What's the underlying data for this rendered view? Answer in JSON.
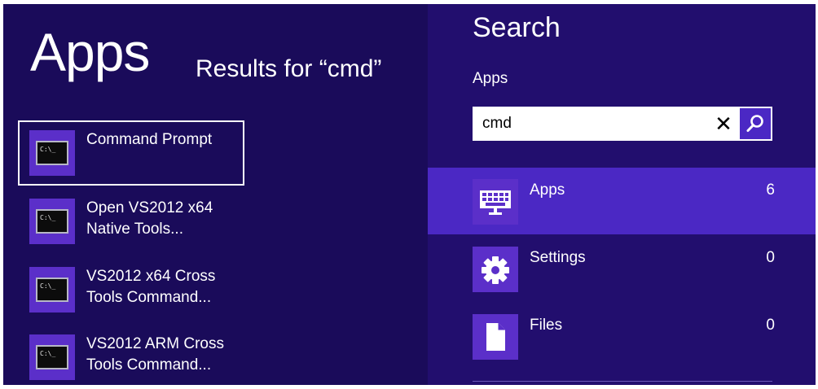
{
  "left": {
    "heading": "Apps",
    "results_for": "Results for “cmd”",
    "results": [
      {
        "line1": "Command Prompt",
        "line2": "",
        "icon": "command-prompt-icon",
        "prompt": "C:\\_"
      },
      {
        "line1": "Open VS2012 x64",
        "line2": "Native Tools...",
        "icon": "command-prompt-icon",
        "prompt": "C:\\_"
      },
      {
        "line1": "VS2012 x64 Cross",
        "line2": "Tools Command...",
        "icon": "command-prompt-icon",
        "prompt": "C:\\_"
      },
      {
        "line1": "VS2012 ARM Cross",
        "line2": "Tools Command...",
        "icon": "command-prompt-icon",
        "prompt": "C:\\_"
      }
    ]
  },
  "search": {
    "title": "Search",
    "scope": "Apps",
    "query": "cmd",
    "clear_glyph": "✕",
    "categories": [
      {
        "label": "Apps",
        "count": "6",
        "icon": "apps-keyboard-icon"
      },
      {
        "label": "Settings",
        "count": "0",
        "icon": "settings-gear-icon"
      },
      {
        "label": "Files",
        "count": "0",
        "icon": "files-document-icon"
      }
    ]
  },
  "colors": {
    "left_background": "#1a0b5a",
    "right_background": "#220e6e",
    "accent": "#4b28c4",
    "tile": "#5b2fc9"
  }
}
